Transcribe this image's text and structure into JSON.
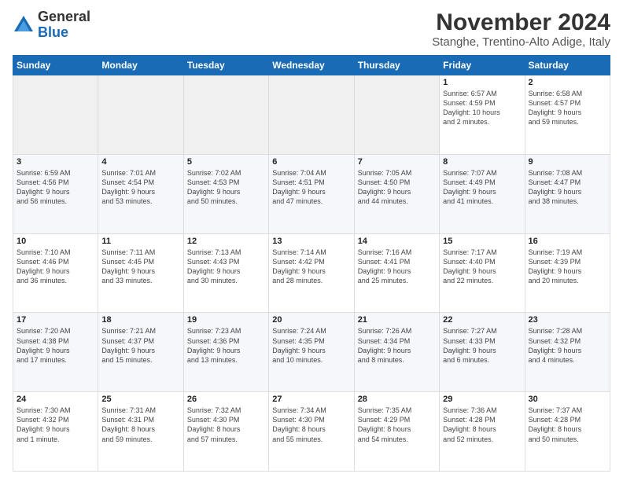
{
  "header": {
    "logo_general": "General",
    "logo_blue": "Blue",
    "month_title": "November 2024",
    "location": "Stanghe, Trentino-Alto Adige, Italy"
  },
  "calendar": {
    "days_of_week": [
      "Sunday",
      "Monday",
      "Tuesday",
      "Wednesday",
      "Thursday",
      "Friday",
      "Saturday"
    ],
    "weeks": [
      [
        {
          "day": "",
          "info": ""
        },
        {
          "day": "",
          "info": ""
        },
        {
          "day": "",
          "info": ""
        },
        {
          "day": "",
          "info": ""
        },
        {
          "day": "",
          "info": ""
        },
        {
          "day": "1",
          "info": "Sunrise: 6:57 AM\nSunset: 4:59 PM\nDaylight: 10 hours\nand 2 minutes."
        },
        {
          "day": "2",
          "info": "Sunrise: 6:58 AM\nSunset: 4:57 PM\nDaylight: 9 hours\nand 59 minutes."
        }
      ],
      [
        {
          "day": "3",
          "info": "Sunrise: 6:59 AM\nSunset: 4:56 PM\nDaylight: 9 hours\nand 56 minutes."
        },
        {
          "day": "4",
          "info": "Sunrise: 7:01 AM\nSunset: 4:54 PM\nDaylight: 9 hours\nand 53 minutes."
        },
        {
          "day": "5",
          "info": "Sunrise: 7:02 AM\nSunset: 4:53 PM\nDaylight: 9 hours\nand 50 minutes."
        },
        {
          "day": "6",
          "info": "Sunrise: 7:04 AM\nSunset: 4:51 PM\nDaylight: 9 hours\nand 47 minutes."
        },
        {
          "day": "7",
          "info": "Sunrise: 7:05 AM\nSunset: 4:50 PM\nDaylight: 9 hours\nand 44 minutes."
        },
        {
          "day": "8",
          "info": "Sunrise: 7:07 AM\nSunset: 4:49 PM\nDaylight: 9 hours\nand 41 minutes."
        },
        {
          "day": "9",
          "info": "Sunrise: 7:08 AM\nSunset: 4:47 PM\nDaylight: 9 hours\nand 38 minutes."
        }
      ],
      [
        {
          "day": "10",
          "info": "Sunrise: 7:10 AM\nSunset: 4:46 PM\nDaylight: 9 hours\nand 36 minutes."
        },
        {
          "day": "11",
          "info": "Sunrise: 7:11 AM\nSunset: 4:45 PM\nDaylight: 9 hours\nand 33 minutes."
        },
        {
          "day": "12",
          "info": "Sunrise: 7:13 AM\nSunset: 4:43 PM\nDaylight: 9 hours\nand 30 minutes."
        },
        {
          "day": "13",
          "info": "Sunrise: 7:14 AM\nSunset: 4:42 PM\nDaylight: 9 hours\nand 28 minutes."
        },
        {
          "day": "14",
          "info": "Sunrise: 7:16 AM\nSunset: 4:41 PM\nDaylight: 9 hours\nand 25 minutes."
        },
        {
          "day": "15",
          "info": "Sunrise: 7:17 AM\nSunset: 4:40 PM\nDaylight: 9 hours\nand 22 minutes."
        },
        {
          "day": "16",
          "info": "Sunrise: 7:19 AM\nSunset: 4:39 PM\nDaylight: 9 hours\nand 20 minutes."
        }
      ],
      [
        {
          "day": "17",
          "info": "Sunrise: 7:20 AM\nSunset: 4:38 PM\nDaylight: 9 hours\nand 17 minutes."
        },
        {
          "day": "18",
          "info": "Sunrise: 7:21 AM\nSunset: 4:37 PM\nDaylight: 9 hours\nand 15 minutes."
        },
        {
          "day": "19",
          "info": "Sunrise: 7:23 AM\nSunset: 4:36 PM\nDaylight: 9 hours\nand 13 minutes."
        },
        {
          "day": "20",
          "info": "Sunrise: 7:24 AM\nSunset: 4:35 PM\nDaylight: 9 hours\nand 10 minutes."
        },
        {
          "day": "21",
          "info": "Sunrise: 7:26 AM\nSunset: 4:34 PM\nDaylight: 9 hours\nand 8 minutes."
        },
        {
          "day": "22",
          "info": "Sunrise: 7:27 AM\nSunset: 4:33 PM\nDaylight: 9 hours\nand 6 minutes."
        },
        {
          "day": "23",
          "info": "Sunrise: 7:28 AM\nSunset: 4:32 PM\nDaylight: 9 hours\nand 4 minutes."
        }
      ],
      [
        {
          "day": "24",
          "info": "Sunrise: 7:30 AM\nSunset: 4:32 PM\nDaylight: 9 hours\nand 1 minute."
        },
        {
          "day": "25",
          "info": "Sunrise: 7:31 AM\nSunset: 4:31 PM\nDaylight: 8 hours\nand 59 minutes."
        },
        {
          "day": "26",
          "info": "Sunrise: 7:32 AM\nSunset: 4:30 PM\nDaylight: 8 hours\nand 57 minutes."
        },
        {
          "day": "27",
          "info": "Sunrise: 7:34 AM\nSunset: 4:30 PM\nDaylight: 8 hours\nand 55 minutes."
        },
        {
          "day": "28",
          "info": "Sunrise: 7:35 AM\nSunset: 4:29 PM\nDaylight: 8 hours\nand 54 minutes."
        },
        {
          "day": "29",
          "info": "Sunrise: 7:36 AM\nSunset: 4:28 PM\nDaylight: 8 hours\nand 52 minutes."
        },
        {
          "day": "30",
          "info": "Sunrise: 7:37 AM\nSunset: 4:28 PM\nDaylight: 8 hours\nand 50 minutes."
        }
      ]
    ]
  }
}
